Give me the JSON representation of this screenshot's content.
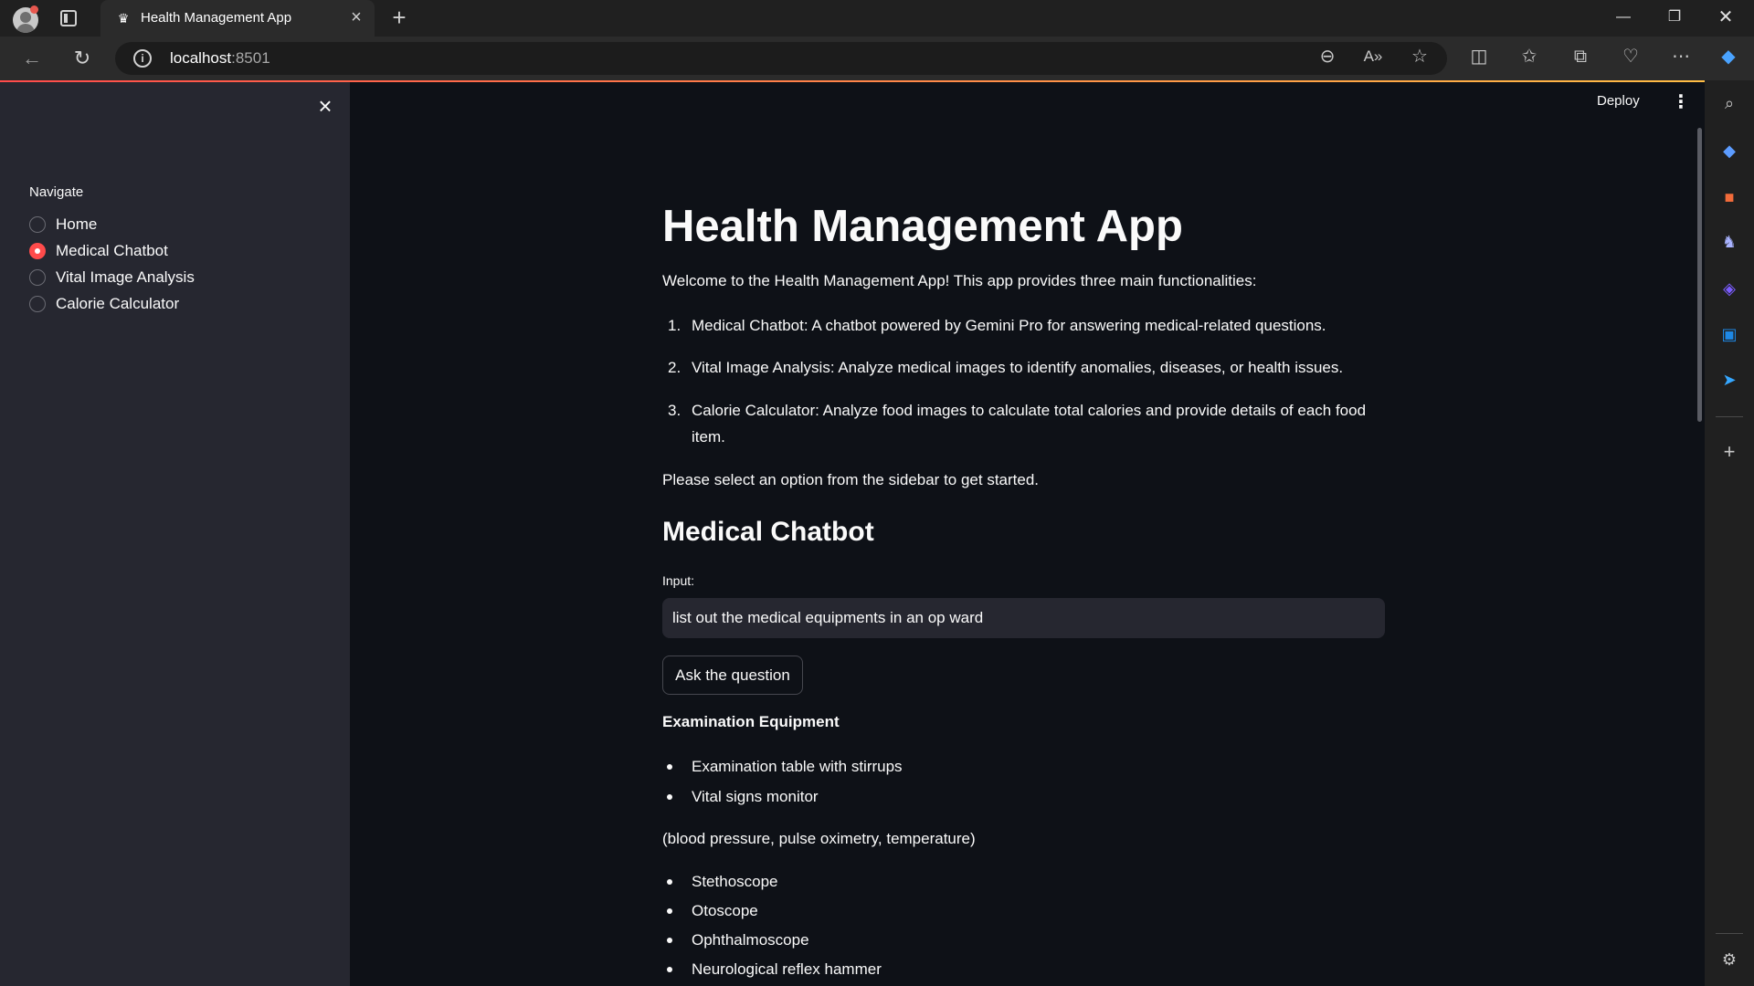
{
  "browser": {
    "tab_title": "Health Management App",
    "url_host": "localhost",
    "url_port": ":8501"
  },
  "sidebar": {
    "nav_label": "Navigate",
    "options": [
      "Home",
      "Medical Chatbot",
      "Vital Image Analysis",
      "Calorie Calculator"
    ],
    "selected": "Medical Chatbot"
  },
  "header": {
    "deploy_label": "Deploy"
  },
  "main": {
    "title": "Health Management App",
    "intro": "Welcome to the Health Management App! This app provides three main functionalities:",
    "features": [
      "Medical Chatbot: A chatbot powered by Gemini Pro for answering medical-related questions.",
      "Vital Image Analysis: Analyze medical images to identify anomalies, diseases, or health issues.",
      "Calorie Calculator: Analyze food images to calculate total calories and provide details of each food item."
    ],
    "prompt": "Please select an option from the sidebar to get started.",
    "section_title": "Medical Chatbot",
    "input_label": "Input:",
    "input_value": "list out the medical equipments in an op ward",
    "ask_button": "Ask the question",
    "answer_heading": "Examination Equipment",
    "answer_list_1": [
      "Examination table with stirrups",
      "Vital signs monitor"
    ],
    "answer_note": "(blood pressure, pulse oximetry, temperature)",
    "answer_list_2": [
      "Stethoscope",
      "Otoscope",
      "Ophthalmoscope",
      "Neurological reflex hammer"
    ]
  },
  "colors": {
    "accent": "#ff4b4b",
    "background": "#0e1117",
    "sidebar_bg": "#262730"
  }
}
